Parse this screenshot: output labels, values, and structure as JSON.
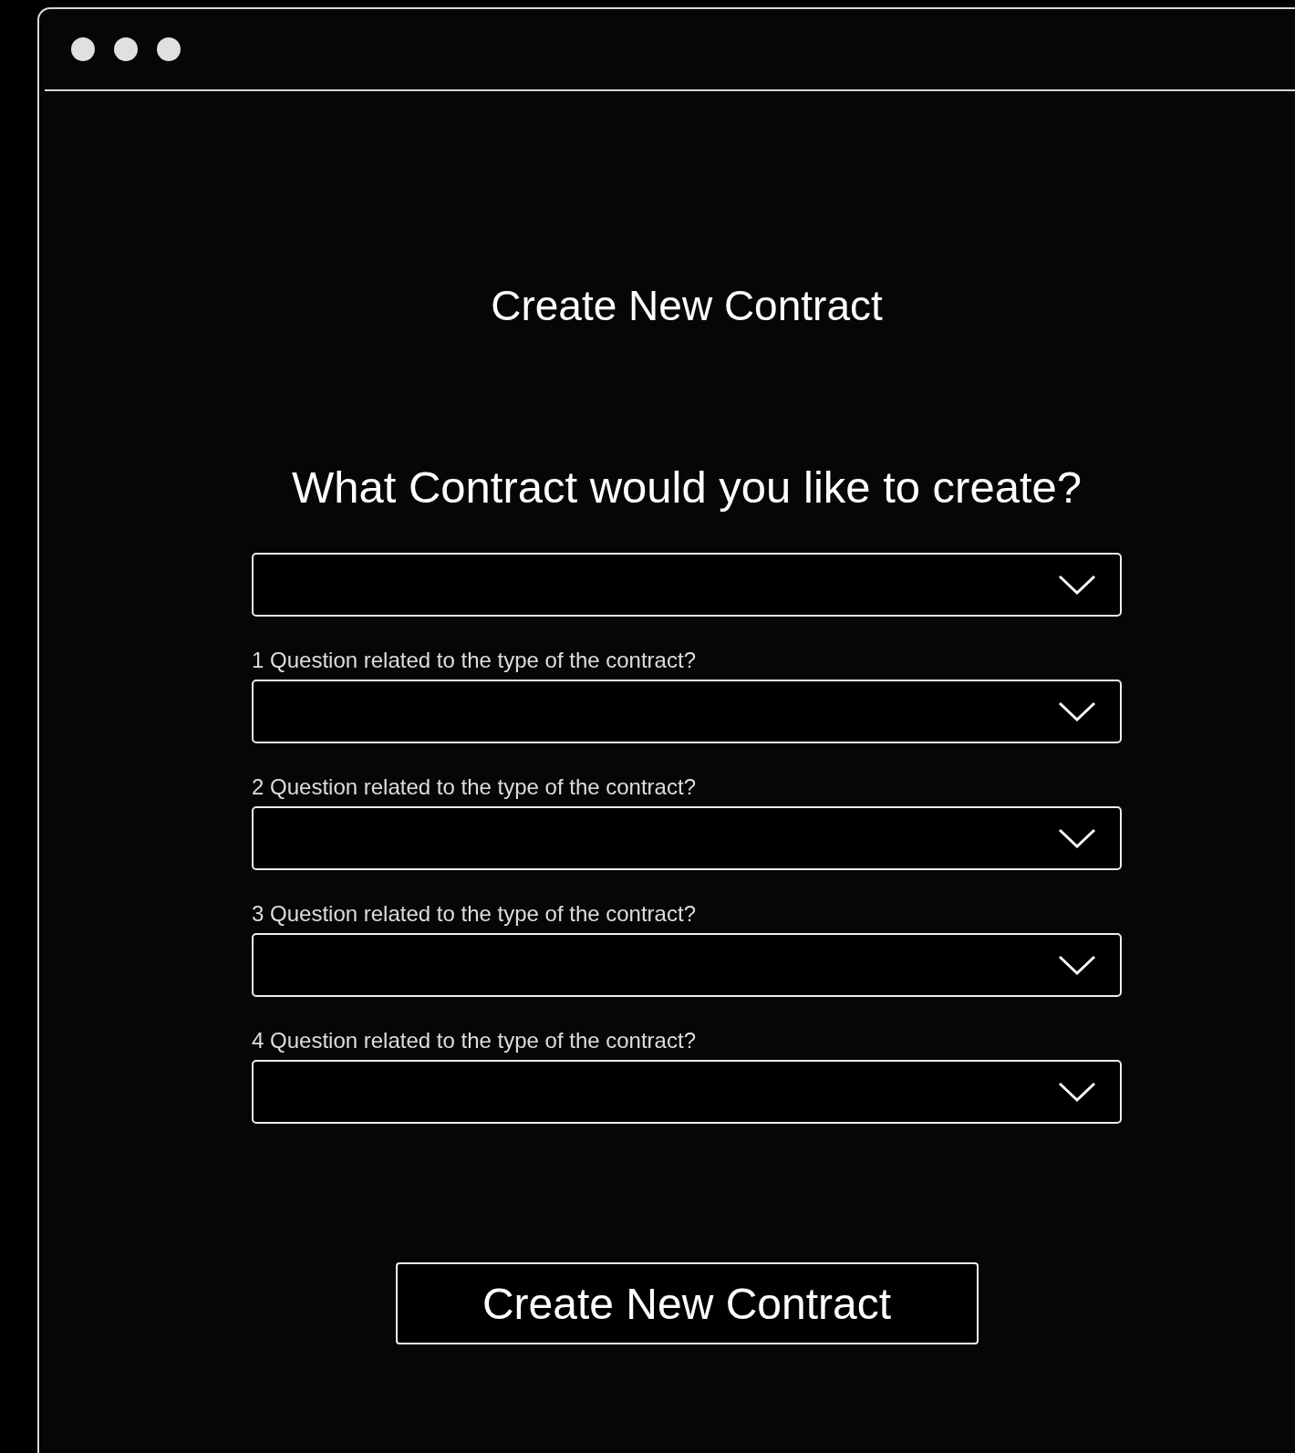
{
  "page_title": "Create New Contract",
  "question": "What Contract would you like to create?",
  "fields": [
    {
      "kind": "dropdown"
    },
    {
      "kind": "dropdown",
      "label": "1 Question related to the type of the contract?"
    },
    {
      "kind": "dropdown",
      "label": "2 Question related to the type of the contract?"
    },
    {
      "kind": "dropdown",
      "label": "3 Question related to the type of the contract?"
    },
    {
      "kind": "dropdown",
      "label": "4 Question related to the type of the contract?"
    }
  ],
  "submit_button": "Create New Contract"
}
